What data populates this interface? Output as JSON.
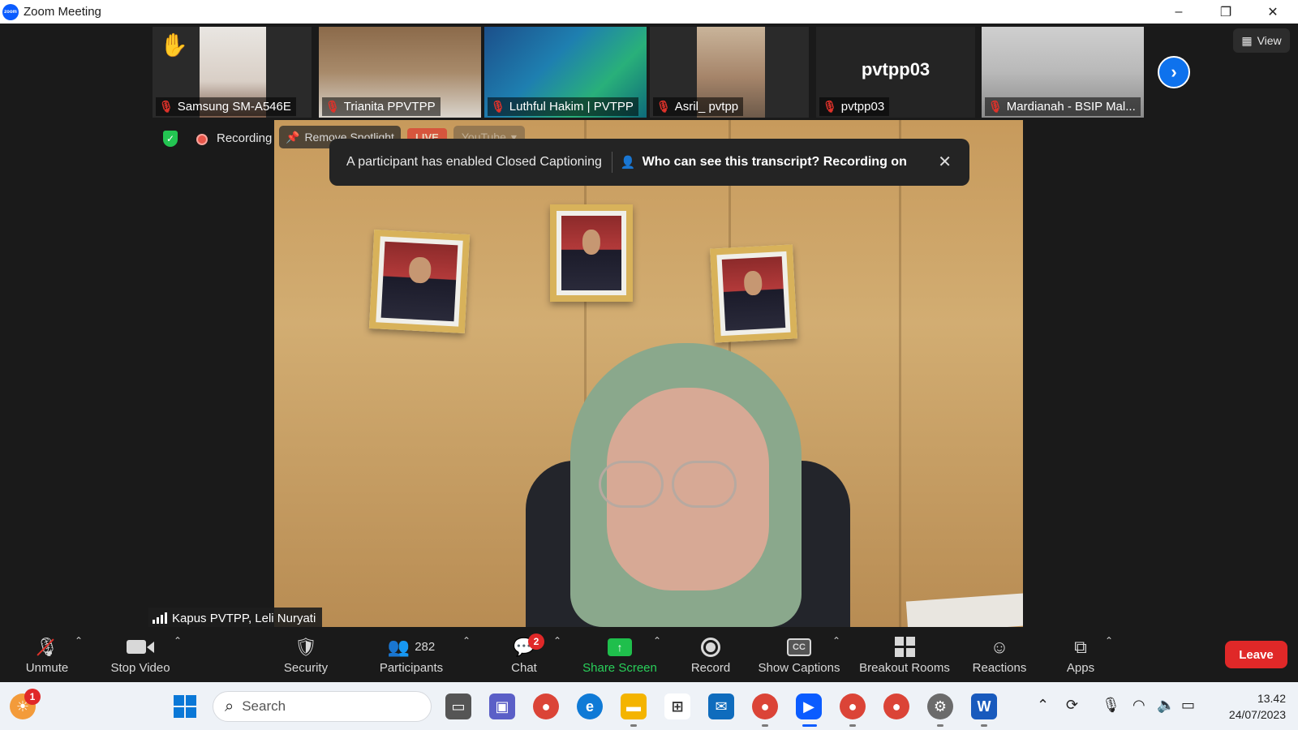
{
  "window": {
    "title": "Zoom Meeting",
    "logo_text": "zoom",
    "minimize_icon": "–",
    "restore_icon": "❐",
    "close_icon": "✕"
  },
  "thumbnails": [
    {
      "name": "Samsung SM-A546E",
      "muted": true,
      "raised_hand": true
    },
    {
      "name": "Trianita PPVTPP",
      "muted": true
    },
    {
      "name": "Luthful Hakim | PVTPP",
      "muted": true
    },
    {
      "name": "Asril_ pvtpp",
      "muted": true
    },
    {
      "name": "pvtpp03",
      "muted": true,
      "display_name": "pvtpp03"
    },
    {
      "name": "Mardianah - BSIP Mal...",
      "muted": true
    }
  ],
  "view_button": {
    "label": "View",
    "icon": "grid-icon"
  },
  "next_page_icon": "chevron-right-icon",
  "status": {
    "recording_label": "Recording",
    "encryption_icon": "shield-check-icon"
  },
  "spotlight": {
    "remove_spotlight_label": "Remove Spotlight",
    "live_label": "LIVE",
    "youtube_label": "YouTube"
  },
  "captions_toast": {
    "message": "A participant has enabled Closed Captioning",
    "link": "Who can see this transcript? Recording on",
    "close_icon": "✕"
  },
  "active_speaker": {
    "name": "Kapus PVTPP, Leli Nuryati"
  },
  "toolbar": {
    "unmute": "Unmute",
    "stop_video": "Stop Video",
    "security": "Security",
    "participants": "Participants",
    "participants_count": "282",
    "chat": "Chat",
    "chat_badge": "2",
    "share_screen": "Share Screen",
    "record": "Record",
    "show_captions": "Show Captions",
    "breakout_rooms": "Breakout Rooms",
    "reactions": "Reactions",
    "apps": "Apps",
    "leave": "Leave",
    "cc_icon_text": "CC"
  },
  "taskbar": {
    "search_placeholder": "Search",
    "weather_badge": "1",
    "time": "13.42",
    "date": "24/07/2023",
    "word_letter": "W"
  },
  "colors": {
    "zoom_blue": "#0e72ed",
    "leave_red": "#e02828",
    "share_green": "#1fbf4c",
    "mute_red": "#e0322a",
    "background": "#1a1a1a"
  }
}
